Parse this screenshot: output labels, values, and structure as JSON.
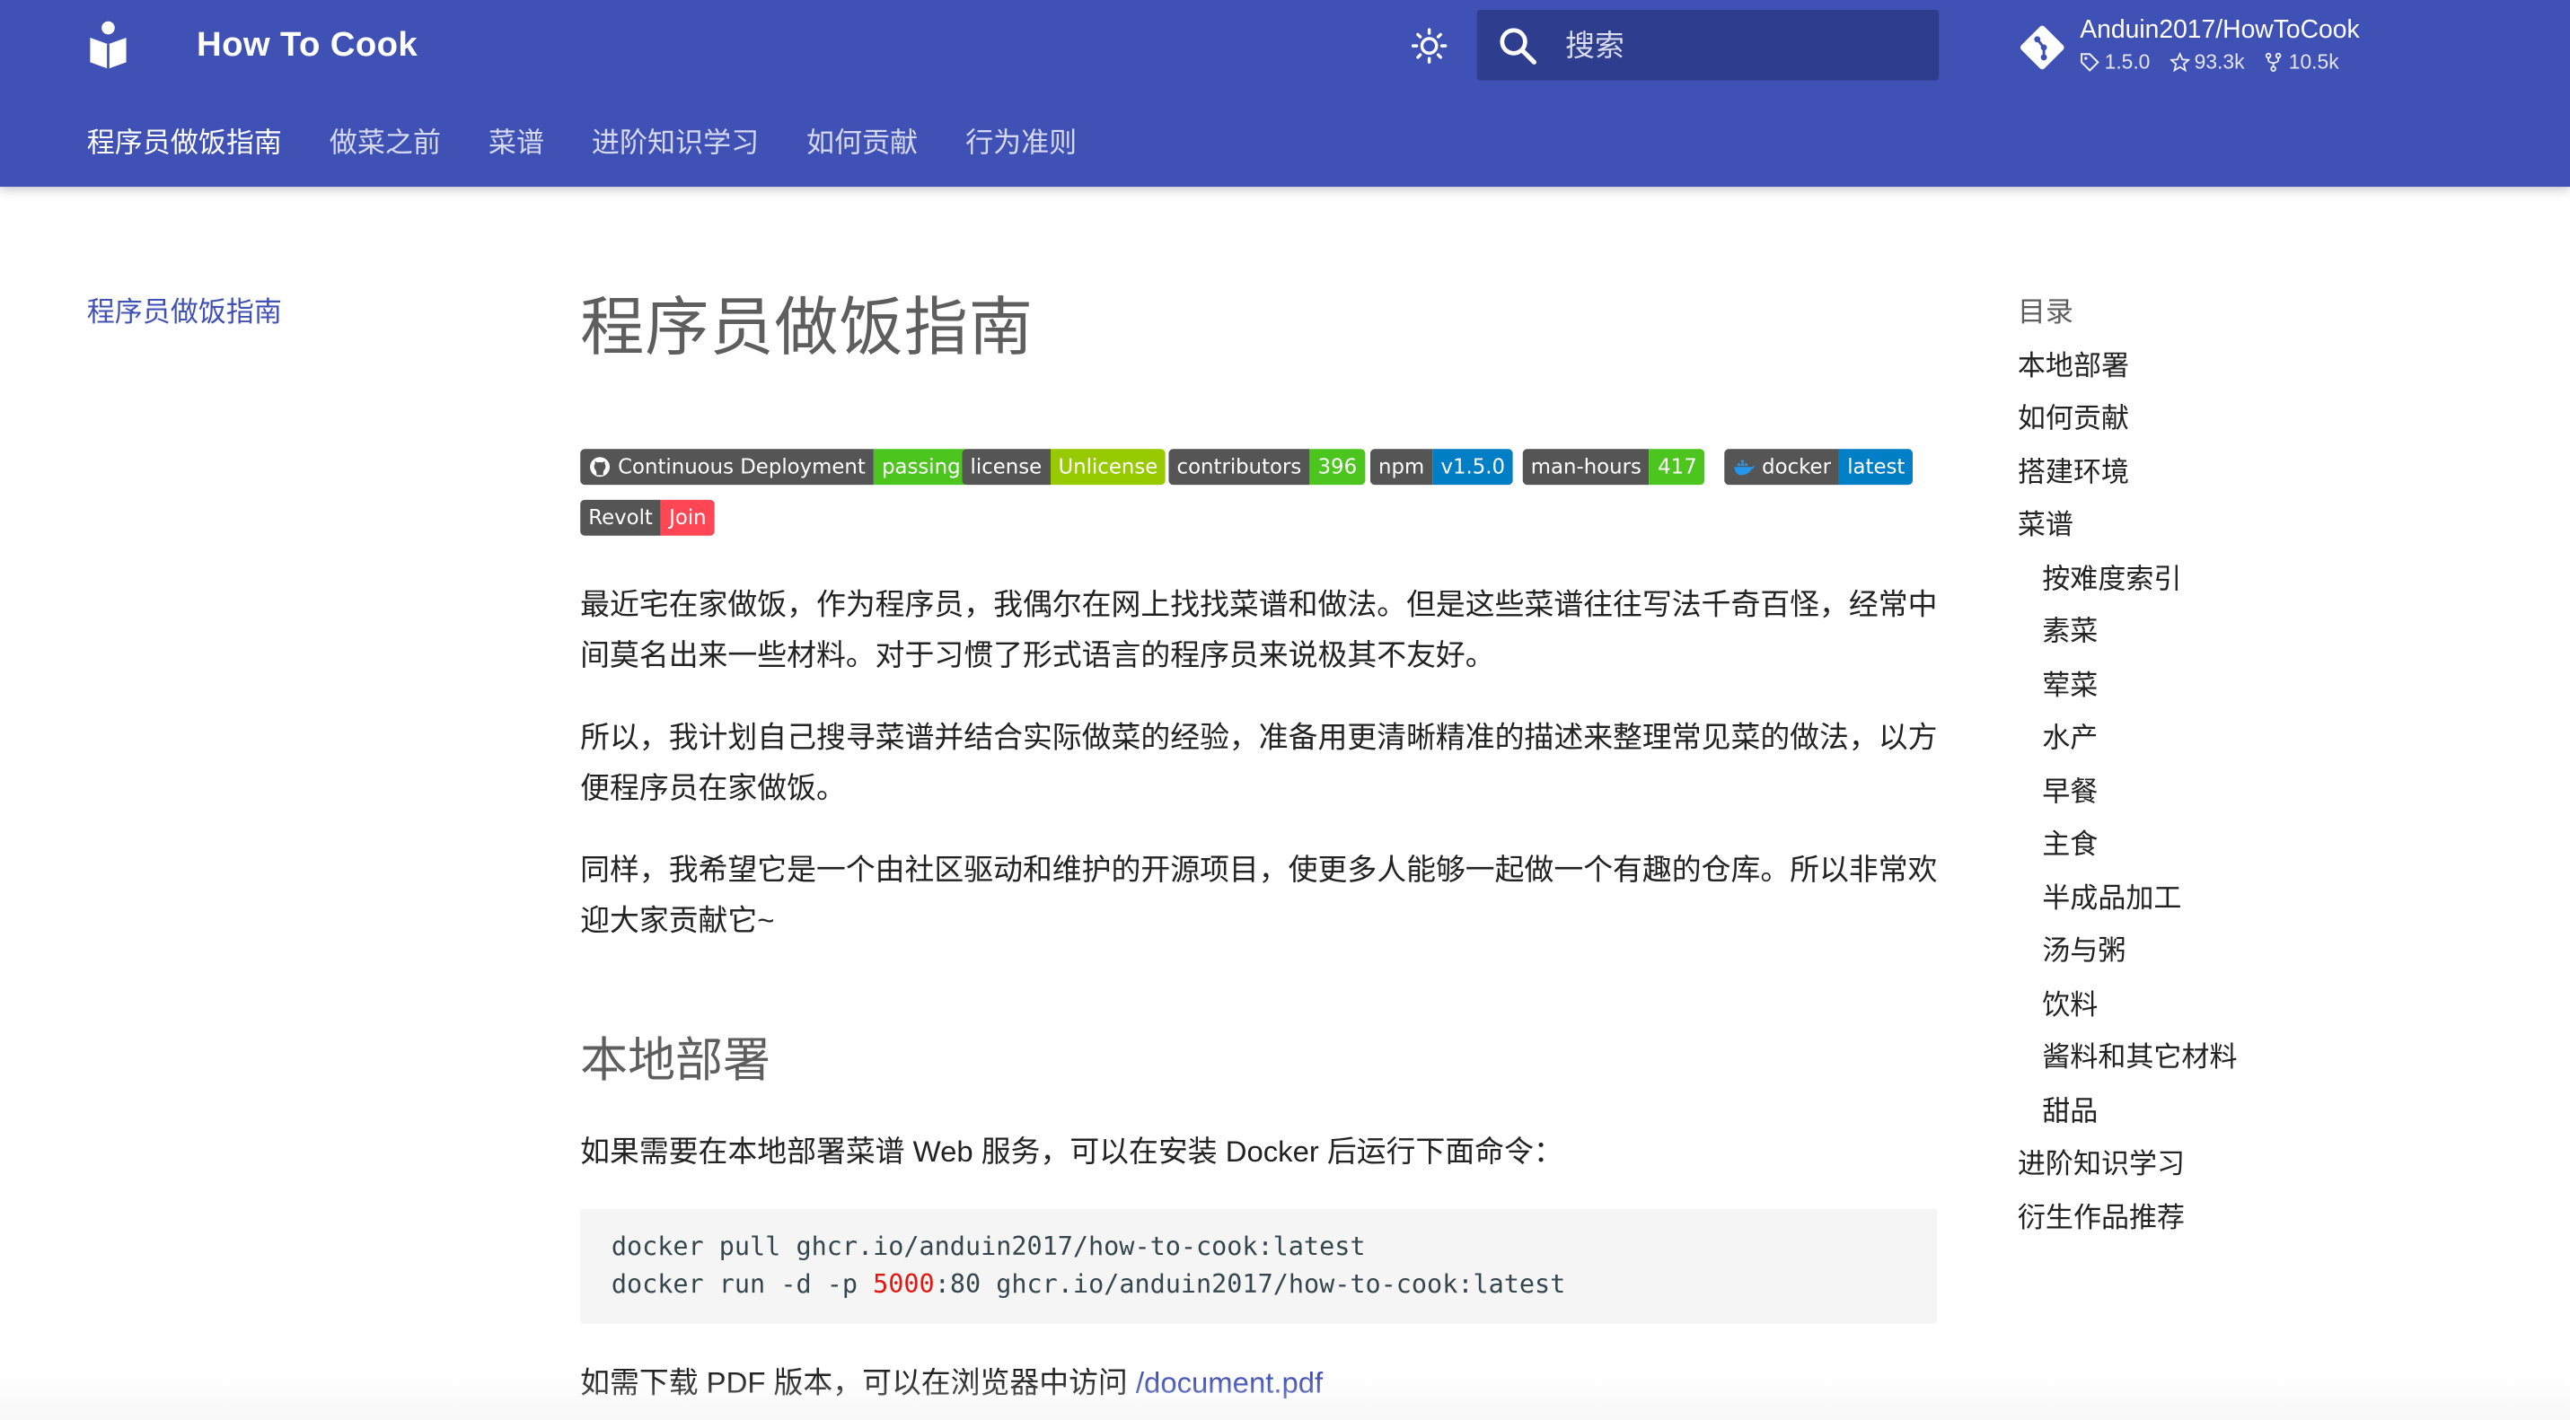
{
  "header": {
    "site_title": "How To Cook",
    "search_placeholder": "搜索",
    "repo": {
      "name": "Anduin2017/HowToCook",
      "version": "1.5.0",
      "stars": "93.3k",
      "forks": "10.5k"
    },
    "tabs": [
      {
        "label": "程序员做饭指南",
        "active": true
      },
      {
        "label": "做菜之前",
        "active": false
      },
      {
        "label": "菜谱",
        "active": false
      },
      {
        "label": "进阶知识学习",
        "active": false
      },
      {
        "label": "如何贡献",
        "active": false
      },
      {
        "label": "行为准则",
        "active": false
      }
    ]
  },
  "left_nav": {
    "items": [
      {
        "label": "程序员做饭指南"
      }
    ]
  },
  "content": {
    "title": "程序员做饭指南",
    "badges": [
      {
        "left": "Continuous Deployment",
        "right": "passing",
        "color": "#4cc61e"
      },
      {
        "left": "license",
        "right": "Unlicense",
        "color": "#97ca00"
      },
      {
        "left": "contributors",
        "right": "396",
        "color": "#4cc61e"
      },
      {
        "left": "npm",
        "right": "v1.5.0",
        "color": "#007ec6"
      },
      {
        "left": "man-hours",
        "right": "417",
        "color": "#4cc61e"
      },
      {
        "left": "docker",
        "right": "latest",
        "color": "#007ec6"
      },
      {
        "left": "Revolt",
        "right": "Join",
        "color": "#ff4654"
      }
    ],
    "paragraphs": [
      "最近宅在家做饭，作为程序员，我偶尔在网上找找菜谱和做法。但是这些菜谱往往写法千奇百怪，经常中间莫名出来一些材料。对于习惯了形式语言的程序员来说极其不友好。",
      "所以，我计划自己搜寻菜谱并结合实际做菜的经验，准备用更清晰精准的描述来整理常见菜的做法，以方便程序员在家做饭。",
      "同样，我希望它是一个由社区驱动和维护的开源项目，使更多人能够一起做一个有趣的仓库。所以非常欢迎大家贡献它~"
    ],
    "section_title": "本地部署",
    "section_intro": "如果需要在本地部署菜谱 Web 服务，可以在安装 Docker 后运行下面命令：",
    "code": {
      "line1": "docker pull ghcr.io/anduin2017/how-to-cook:latest",
      "line2_a": "docker run -d -p ",
      "line2_num": "5000",
      "line2_b": ":80 ghcr.io/anduin2017/how-to-cook:latest"
    },
    "pdf_text": "如需下载 PDF 版本，可以在浏览器中访问 ",
    "pdf_link": "/document.pdf"
  },
  "toc": {
    "title": "目录",
    "items": [
      {
        "label": "本地部署",
        "level": 1
      },
      {
        "label": "如何贡献",
        "level": 1
      },
      {
        "label": "搭建环境",
        "level": 1
      },
      {
        "label": "菜谱",
        "level": 1
      },
      {
        "label": "按难度索引",
        "level": 2
      },
      {
        "label": "素菜",
        "level": 2
      },
      {
        "label": "荤菜",
        "level": 2
      },
      {
        "label": "水产",
        "level": 2
      },
      {
        "label": "早餐",
        "level": 2
      },
      {
        "label": "主食",
        "level": 2
      },
      {
        "label": "半成品加工",
        "level": 2
      },
      {
        "label": "汤与粥",
        "level": 2
      },
      {
        "label": "饮料",
        "level": 2
      },
      {
        "label": "酱料和其它材料",
        "level": 2
      },
      {
        "label": "甜品",
        "level": 2
      },
      {
        "label": "进阶知识学习",
        "level": 1
      },
      {
        "label": "衍生作品推荐",
        "level": 1
      }
    ]
  },
  "colors": {
    "primary": "#4051b5",
    "search_bg": "#2f3d8f",
    "link": "#4051b5"
  }
}
